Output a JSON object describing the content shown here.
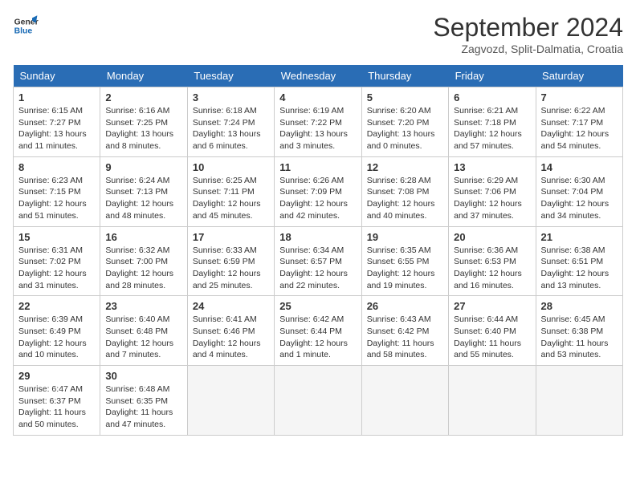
{
  "header": {
    "logo_line1": "General",
    "logo_line2": "Blue",
    "month": "September 2024",
    "location": "Zagvozd, Split-Dalmatia, Croatia"
  },
  "weekdays": [
    "Sunday",
    "Monday",
    "Tuesday",
    "Wednesday",
    "Thursday",
    "Friday",
    "Saturday"
  ],
  "weeks": [
    [
      {
        "day": "1",
        "info": "Sunrise: 6:15 AM\nSunset: 7:27 PM\nDaylight: 13 hours\nand 11 minutes."
      },
      {
        "day": "2",
        "info": "Sunrise: 6:16 AM\nSunset: 7:25 PM\nDaylight: 13 hours\nand 8 minutes."
      },
      {
        "day": "3",
        "info": "Sunrise: 6:18 AM\nSunset: 7:24 PM\nDaylight: 13 hours\nand 6 minutes."
      },
      {
        "day": "4",
        "info": "Sunrise: 6:19 AM\nSunset: 7:22 PM\nDaylight: 13 hours\nand 3 minutes."
      },
      {
        "day": "5",
        "info": "Sunrise: 6:20 AM\nSunset: 7:20 PM\nDaylight: 13 hours\nand 0 minutes."
      },
      {
        "day": "6",
        "info": "Sunrise: 6:21 AM\nSunset: 7:18 PM\nDaylight: 12 hours\nand 57 minutes."
      },
      {
        "day": "7",
        "info": "Sunrise: 6:22 AM\nSunset: 7:17 PM\nDaylight: 12 hours\nand 54 minutes."
      }
    ],
    [
      {
        "day": "8",
        "info": "Sunrise: 6:23 AM\nSunset: 7:15 PM\nDaylight: 12 hours\nand 51 minutes."
      },
      {
        "day": "9",
        "info": "Sunrise: 6:24 AM\nSunset: 7:13 PM\nDaylight: 12 hours\nand 48 minutes."
      },
      {
        "day": "10",
        "info": "Sunrise: 6:25 AM\nSunset: 7:11 PM\nDaylight: 12 hours\nand 45 minutes."
      },
      {
        "day": "11",
        "info": "Sunrise: 6:26 AM\nSunset: 7:09 PM\nDaylight: 12 hours\nand 42 minutes."
      },
      {
        "day": "12",
        "info": "Sunrise: 6:28 AM\nSunset: 7:08 PM\nDaylight: 12 hours\nand 40 minutes."
      },
      {
        "day": "13",
        "info": "Sunrise: 6:29 AM\nSunset: 7:06 PM\nDaylight: 12 hours\nand 37 minutes."
      },
      {
        "day": "14",
        "info": "Sunrise: 6:30 AM\nSunset: 7:04 PM\nDaylight: 12 hours\nand 34 minutes."
      }
    ],
    [
      {
        "day": "15",
        "info": "Sunrise: 6:31 AM\nSunset: 7:02 PM\nDaylight: 12 hours\nand 31 minutes."
      },
      {
        "day": "16",
        "info": "Sunrise: 6:32 AM\nSunset: 7:00 PM\nDaylight: 12 hours\nand 28 minutes."
      },
      {
        "day": "17",
        "info": "Sunrise: 6:33 AM\nSunset: 6:59 PM\nDaylight: 12 hours\nand 25 minutes."
      },
      {
        "day": "18",
        "info": "Sunrise: 6:34 AM\nSunset: 6:57 PM\nDaylight: 12 hours\nand 22 minutes."
      },
      {
        "day": "19",
        "info": "Sunrise: 6:35 AM\nSunset: 6:55 PM\nDaylight: 12 hours\nand 19 minutes."
      },
      {
        "day": "20",
        "info": "Sunrise: 6:36 AM\nSunset: 6:53 PM\nDaylight: 12 hours\nand 16 minutes."
      },
      {
        "day": "21",
        "info": "Sunrise: 6:38 AM\nSunset: 6:51 PM\nDaylight: 12 hours\nand 13 minutes."
      }
    ],
    [
      {
        "day": "22",
        "info": "Sunrise: 6:39 AM\nSunset: 6:49 PM\nDaylight: 12 hours\nand 10 minutes."
      },
      {
        "day": "23",
        "info": "Sunrise: 6:40 AM\nSunset: 6:48 PM\nDaylight: 12 hours\nand 7 minutes."
      },
      {
        "day": "24",
        "info": "Sunrise: 6:41 AM\nSunset: 6:46 PM\nDaylight: 12 hours\nand 4 minutes."
      },
      {
        "day": "25",
        "info": "Sunrise: 6:42 AM\nSunset: 6:44 PM\nDaylight: 12 hours\nand 1 minute."
      },
      {
        "day": "26",
        "info": "Sunrise: 6:43 AM\nSunset: 6:42 PM\nDaylight: 11 hours\nand 58 minutes."
      },
      {
        "day": "27",
        "info": "Sunrise: 6:44 AM\nSunset: 6:40 PM\nDaylight: 11 hours\nand 55 minutes."
      },
      {
        "day": "28",
        "info": "Sunrise: 6:45 AM\nSunset: 6:38 PM\nDaylight: 11 hours\nand 53 minutes."
      }
    ],
    [
      {
        "day": "29",
        "info": "Sunrise: 6:47 AM\nSunset: 6:37 PM\nDaylight: 11 hours\nand 50 minutes."
      },
      {
        "day": "30",
        "info": "Sunrise: 6:48 AM\nSunset: 6:35 PM\nDaylight: 11 hours\nand 47 minutes."
      },
      {
        "day": "",
        "info": ""
      },
      {
        "day": "",
        "info": ""
      },
      {
        "day": "",
        "info": ""
      },
      {
        "day": "",
        "info": ""
      },
      {
        "day": "",
        "info": ""
      }
    ]
  ]
}
